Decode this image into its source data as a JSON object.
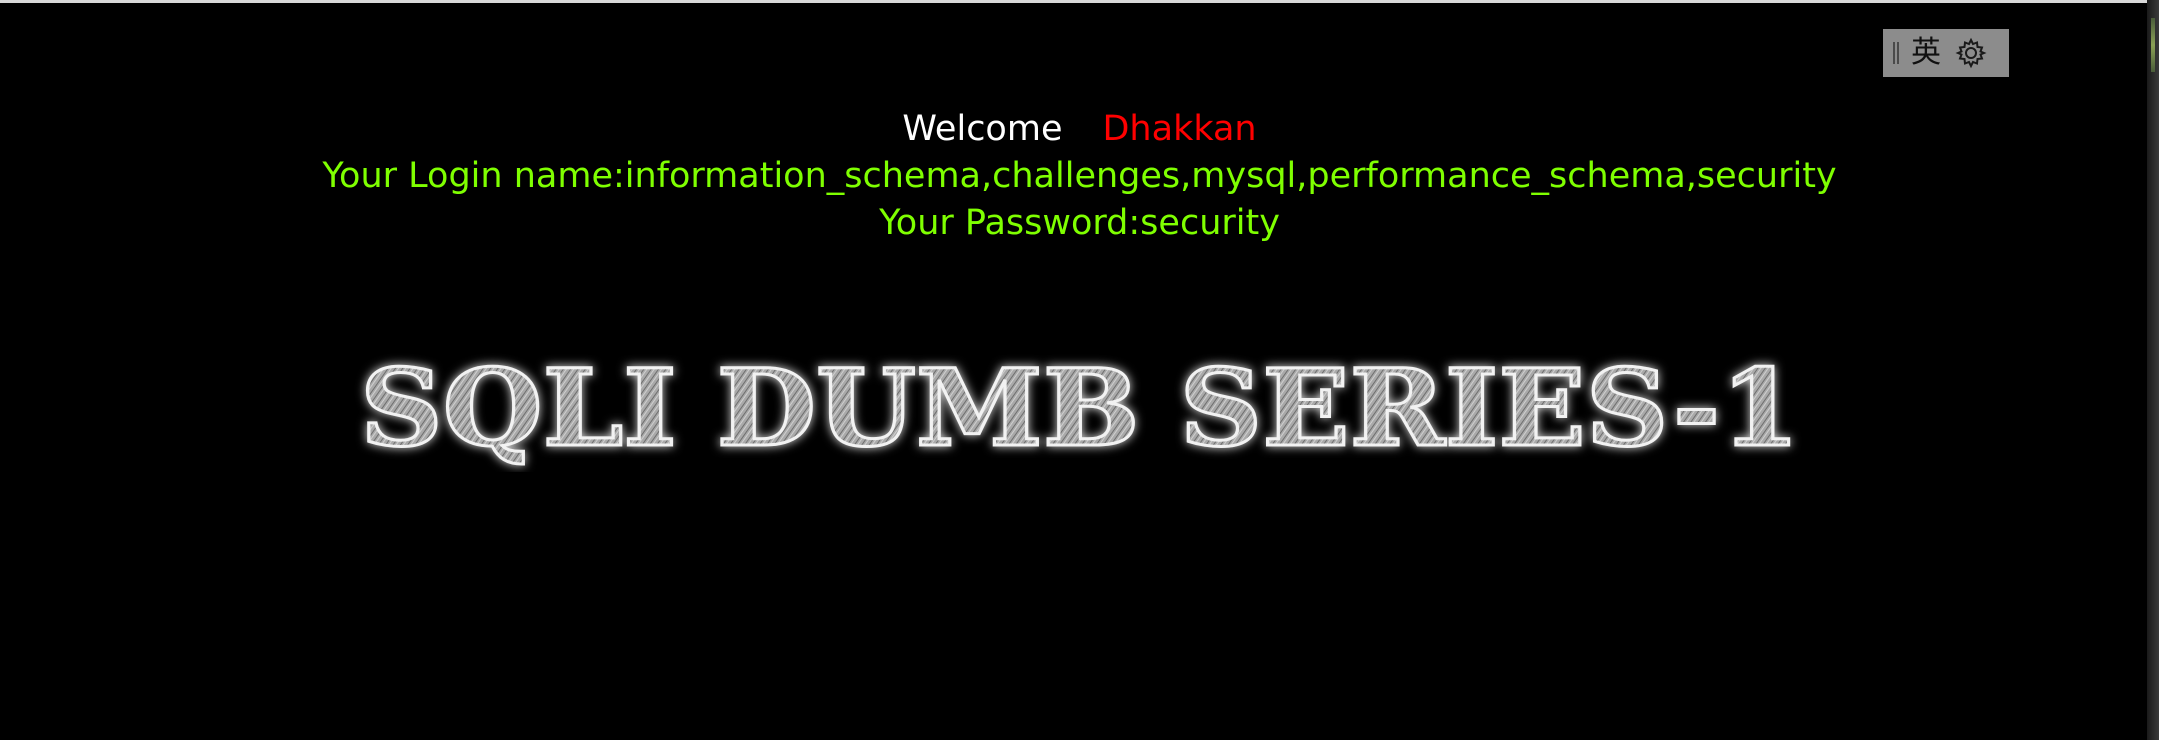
{
  "ime_toolbar": {
    "language_label": "英",
    "icons": [
      "grip-handle-icon",
      "gear-icon"
    ]
  },
  "message": {
    "welcome_label": "Welcome",
    "welcome_name": "Dhakkan",
    "login_line": "Your Login name:information_schema,challenges,mysql,performance_schema,security",
    "password_line": "Your Password:security"
  },
  "banner": {
    "text": "SQLI DUMB SERIES-1"
  },
  "colors": {
    "background": "#000000",
    "welcome": "#ffffff",
    "name": "#ff0000",
    "credentials": "#7fff00",
    "toolbar": "#8c8c8c"
  }
}
